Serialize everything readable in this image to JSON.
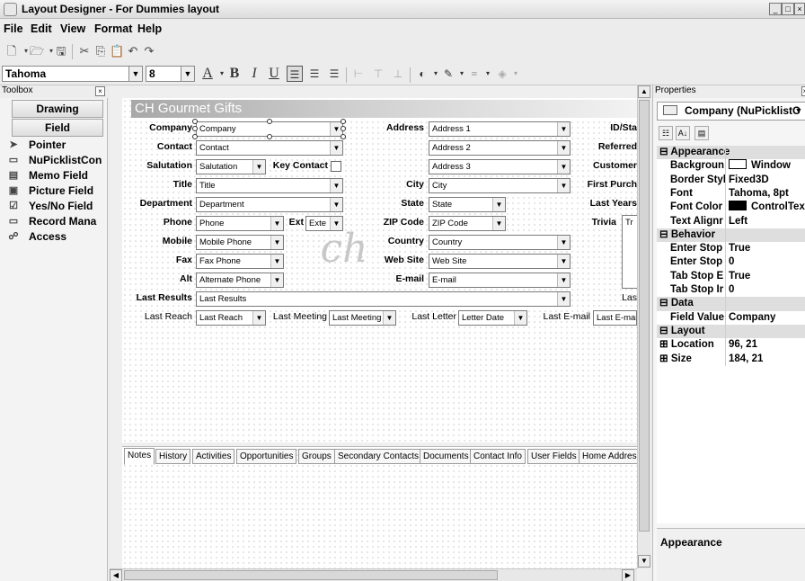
{
  "window": {
    "title": "Layout Designer - For Dummies layout"
  },
  "menu": [
    "File",
    "Edit",
    "View",
    "Format",
    "Help"
  ],
  "format_toolbar": {
    "font_name": "Tahoma",
    "font_size": "8"
  },
  "toolbox": {
    "title": "Toolbox",
    "tabs": [
      "Drawing",
      "Field"
    ],
    "tools": [
      {
        "label": "Pointer",
        "icon": "pointer-icon"
      },
      {
        "label": "NuPicklistCon",
        "icon": "picklist-icon"
      },
      {
        "label": "Memo Field",
        "icon": "memo-icon"
      },
      {
        "label": "Picture Field",
        "icon": "picture-icon"
      },
      {
        "label": "Yes/No Field",
        "icon": "checkbox-icon"
      },
      {
        "label": "Record Mana",
        "icon": "record-icon"
      },
      {
        "label": "Access",
        "icon": "access-icon"
      }
    ]
  },
  "form": {
    "title": "CH Gourmet Gifts",
    "col1": [
      {
        "label": "Company",
        "value": "Company"
      },
      {
        "label": "Contact",
        "value": "Contact"
      },
      {
        "label": "Salutation",
        "value": "Salutation"
      },
      {
        "label": "Title",
        "value": "Title"
      },
      {
        "label": "Department",
        "value": "Department"
      },
      {
        "label": "Phone",
        "value": "Phone"
      },
      {
        "label": "Mobile",
        "value": "Mobile Phone"
      },
      {
        "label": "Fax",
        "value": "Fax Phone"
      },
      {
        "label": "Alt",
        "value": "Alternate Phone"
      }
    ],
    "key_contact_label": "Key Contact",
    "ext_label": "Ext",
    "ext_value": "Exte",
    "col2": [
      {
        "label": "Address",
        "value": "Address 1"
      },
      {
        "label": "",
        "value": "Address 2"
      },
      {
        "label": "",
        "value": "Address 3"
      },
      {
        "label": "City",
        "value": "City"
      },
      {
        "label": "State",
        "value": "State"
      },
      {
        "label": "ZIP Code",
        "value": "ZIP Code"
      },
      {
        "label": "Country",
        "value": "Country"
      },
      {
        "label": "Web Site",
        "value": "Web Site"
      },
      {
        "label": "E-mail",
        "value": "E-mail"
      }
    ],
    "col3_labels": [
      "ID/Sta",
      "Referred",
      "Customer",
      "First Purch",
      "Last Years",
      "Trivia"
    ],
    "trivia_value": "Tr",
    "last_results": {
      "label": "Last Results",
      "value": "Last Results",
      "right_label": "Las"
    },
    "last_row": [
      {
        "label": "Last Reach",
        "value": "Last Reach"
      },
      {
        "label": "Last Meeting",
        "value": "Last Meeting"
      },
      {
        "label": "Last Letter",
        "value": "Letter Date"
      },
      {
        "label": "Last E-mail",
        "value": "Last E-mail"
      }
    ]
  },
  "tabs": [
    "Notes",
    "History",
    "Activities",
    "Opportunities",
    "Groups",
    "Secondary Contacts",
    "Documents",
    "Contact Info",
    "User Fields",
    "Home Address"
  ],
  "properties": {
    "title": "Properties",
    "selected_object": "Company (NuPicklistC",
    "rows": [
      {
        "type": "category",
        "name": "Appearance"
      },
      {
        "name": "Backgroun",
        "value": "Window",
        "swatch": "#ffffff"
      },
      {
        "name": "Border Styl",
        "value": "Fixed3D"
      },
      {
        "name": "Font",
        "value": "Tahoma, 8pt"
      },
      {
        "name": "Font Color",
        "value": "ControlText",
        "swatch": "#000000"
      },
      {
        "name": "Text Alignr",
        "value": "Left"
      },
      {
        "type": "category",
        "name": "Behavior"
      },
      {
        "name": "Enter Stop",
        "value": "True"
      },
      {
        "name": "Enter Stop",
        "value": "0"
      },
      {
        "name": "Tab Stop E",
        "value": "True"
      },
      {
        "name": "Tab Stop Ir",
        "value": "0"
      },
      {
        "type": "category",
        "name": "Data"
      },
      {
        "name": "Field Value",
        "value": "Company"
      },
      {
        "type": "category",
        "name": "Layout"
      },
      {
        "name": "Location",
        "value": "96, 21",
        "expandable": true
      },
      {
        "name": "Size",
        "value": "184, 21",
        "expandable": true
      }
    ],
    "description": "Appearance"
  },
  "colors": {
    "form_title_text": "#ffffff",
    "category_bg": "#dedede"
  }
}
